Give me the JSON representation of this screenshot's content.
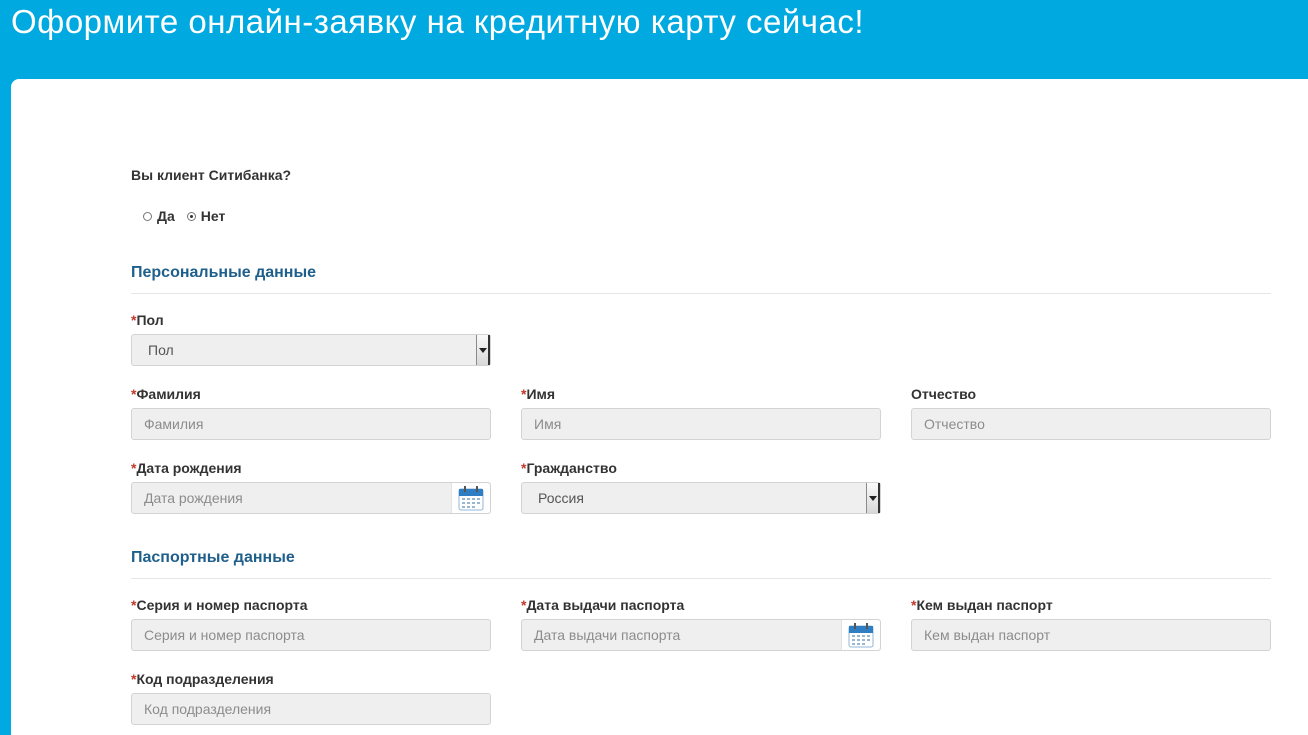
{
  "header": {
    "title": "Оформите онлайн-заявку на кредитную карту сейчас!"
  },
  "client_question": {
    "label": "Вы клиент Ситибанка?",
    "options": [
      {
        "label": "Да",
        "selected": false
      },
      {
        "label": "Нет",
        "selected": true
      }
    ]
  },
  "personal": {
    "title": "Персональные данные",
    "gender": {
      "label": "Пол",
      "value": "Пол"
    },
    "last_name": {
      "label": "Фамилия",
      "placeholder": "Фамилия"
    },
    "first_name": {
      "label": "Имя",
      "placeholder": "Имя"
    },
    "middle_name": {
      "label": "Отчество",
      "placeholder": "Отчество"
    },
    "birth_date": {
      "label": "Дата рождения",
      "placeholder": "Дата рождения"
    },
    "citizenship": {
      "label": "Гражданство",
      "value": "Россия"
    }
  },
  "passport": {
    "title": "Паспортные данные",
    "number": {
      "label": "Серия и номер паспорта",
      "placeholder": "Серия и номер паспорта"
    },
    "issue_date": {
      "label": "Дата выдачи паспорта",
      "placeholder": "Дата выдачи паспорта"
    },
    "issued_by": {
      "label": "Кем выдан паспорт",
      "placeholder": "Кем выдан паспорт"
    },
    "division_code": {
      "label": "Код подразделения",
      "placeholder": "Код подразделения"
    }
  },
  "required_mark": "*",
  "colors": {
    "header_bg": "#00a9e0",
    "section_title": "#1f5f8b",
    "required": "#c0392b"
  }
}
